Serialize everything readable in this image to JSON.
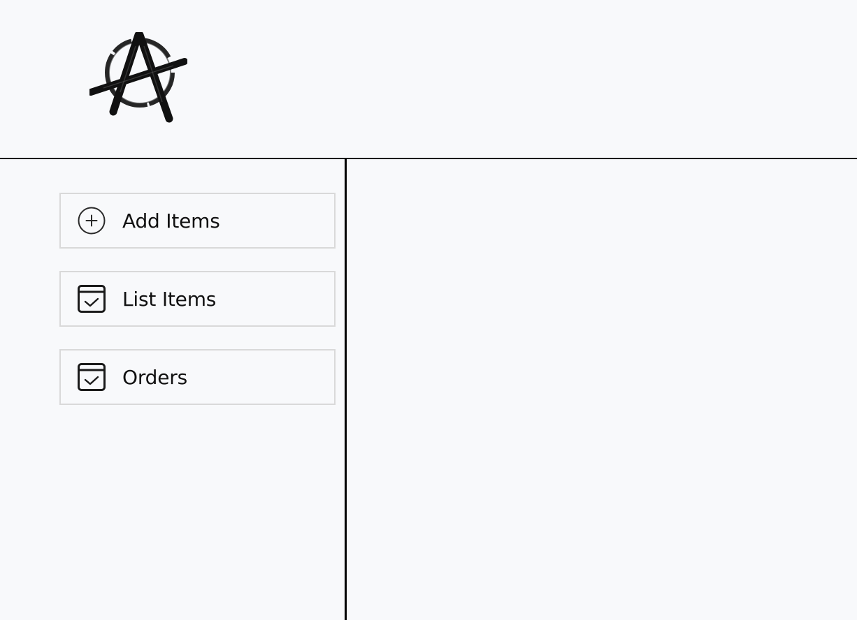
{
  "header": {
    "logo_icon": "anarchy-logo"
  },
  "sidebar": {
    "items": [
      {
        "label": "Add Items",
        "icon": "add-circle-icon"
      },
      {
        "label": "List Items",
        "icon": "calendar-check-icon"
      },
      {
        "label": "Orders",
        "icon": "calendar-check-icon"
      }
    ]
  },
  "colors": {
    "background": "#f8f9fb",
    "divider": "#000000",
    "item_border": "#d9d9d9"
  }
}
